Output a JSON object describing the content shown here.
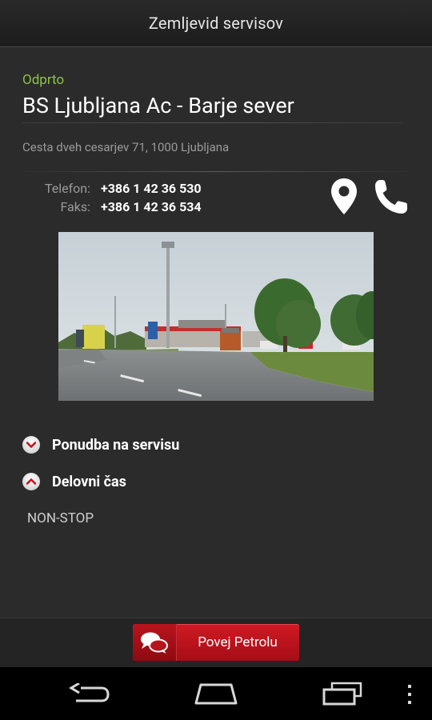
{
  "titlebar": {
    "title": "Zemljevid servisov"
  },
  "station": {
    "status": "Odprto",
    "name": "BS Ljubljana Ac - Barje sever",
    "address": "Cesta dveh cesarjev 71, 1000 Ljubljana",
    "phone_label": "Telefon:",
    "phone_value": "+386 1 42 36 530",
    "fax_label": "Faks:",
    "fax_value": "+386 1 42 36 534"
  },
  "actions": {
    "map_icon": "map-pin-icon",
    "call_icon": "phone-icon"
  },
  "sections": {
    "offer_label": "Ponudba na servisu",
    "offer_icon": "chevron-down-icon",
    "hours_label": "Delovni čas",
    "hours_icon": "chevron-up-icon",
    "hours_value": "NON-STOP"
  },
  "feedback": {
    "label": "Povej Petrolu",
    "icon": "chat-bubbles-icon"
  },
  "navbar": {
    "back_icon": "back-icon",
    "home_icon": "home-icon",
    "recents_icon": "recents-icon",
    "menu_icon": "overflow-menu-icon"
  },
  "colors": {
    "status_open": "#8cc63f",
    "accent": "#c8121c",
    "background": "#2b2b2b"
  }
}
